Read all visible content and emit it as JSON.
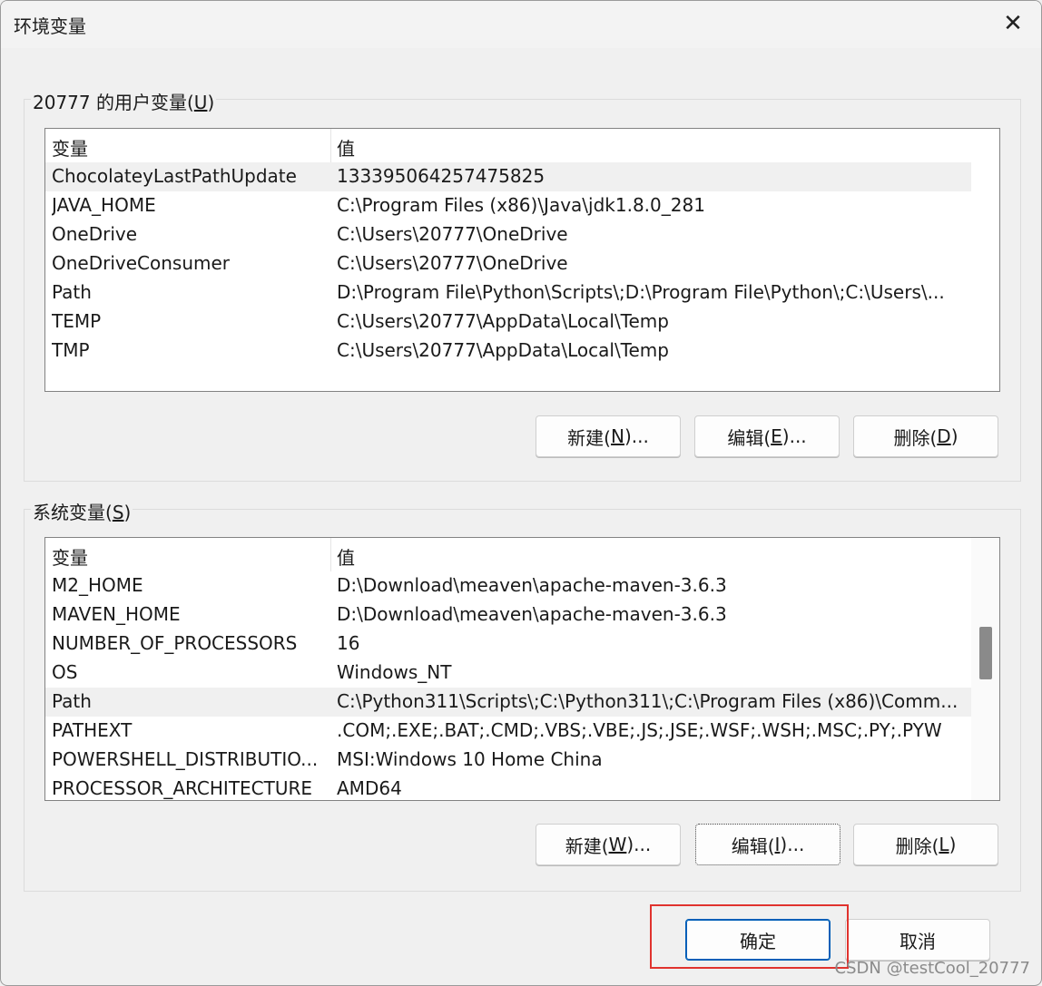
{
  "window": {
    "title": "环境变量",
    "close_glyph": "✕"
  },
  "user_vars": {
    "label_prefix": "20777 的用户变量(",
    "label_key": "U",
    "label_suffix": ")",
    "columns": [
      "变量",
      "值"
    ],
    "rows": [
      {
        "name": "ChocolateyLastPathUpdate",
        "value": "133395064257475825",
        "selected": true
      },
      {
        "name": "JAVA_HOME",
        "value": "C:\\Program Files (x86)\\Java\\jdk1.8.0_281"
      },
      {
        "name": "OneDrive",
        "value": "C:\\Users\\20777\\OneDrive"
      },
      {
        "name": "OneDriveConsumer",
        "value": "C:\\Users\\20777\\OneDrive"
      },
      {
        "name": "Path",
        "value": "D:\\Program File\\Python\\Scripts\\;D:\\Program File\\Python\\;C:\\Users\\..."
      },
      {
        "name": "TEMP",
        "value": "C:\\Users\\20777\\AppData\\Local\\Temp"
      },
      {
        "name": "TMP",
        "value": "C:\\Users\\20777\\AppData\\Local\\Temp"
      }
    ],
    "buttons": {
      "new": {
        "pre": "新建(",
        "key": "N",
        "post": ")..."
      },
      "edit": {
        "pre": "编辑(",
        "key": "E",
        "post": ")..."
      },
      "delete": {
        "pre": "删除(",
        "key": "D",
        "post": ")"
      }
    }
  },
  "system_vars": {
    "label_prefix": "系统变量(",
    "label_key": "S",
    "label_suffix": ")",
    "columns": [
      "变量",
      "值"
    ],
    "rows": [
      {
        "name": "M2_HOME",
        "value": "D:\\Download\\meaven\\apache-maven-3.6.3"
      },
      {
        "name": "MAVEN_HOME",
        "value": "D:\\Download\\meaven\\apache-maven-3.6.3"
      },
      {
        "name": "NUMBER_OF_PROCESSORS",
        "value": "16"
      },
      {
        "name": "OS",
        "value": "Windows_NT"
      },
      {
        "name": "Path",
        "value": "C:\\Python311\\Scripts\\;C:\\Python311\\;C:\\Program Files (x86)\\Comm...",
        "selected": true
      },
      {
        "name": "PATHEXT",
        "value": ".COM;.EXE;.BAT;.CMD;.VBS;.VBE;.JS;.JSE;.WSF;.WSH;.MSC;.PY;.PYW"
      },
      {
        "name": "POWERSHELL_DISTRIBUTIO...",
        "value": "MSI:Windows 10 Home China"
      },
      {
        "name": "PROCESSOR_ARCHITECTURE",
        "value": "AMD64"
      }
    ],
    "buttons": {
      "new": {
        "pre": "新建(",
        "key": "W",
        "post": ")..."
      },
      "edit": {
        "pre": "编辑(",
        "key": "I",
        "post": ")..."
      },
      "delete": {
        "pre": "删除(",
        "key": "L",
        "post": ")"
      }
    }
  },
  "footer": {
    "ok_label": "确定",
    "cancel_label": "取消",
    "highlight_color": "#e0332e"
  },
  "watermark": "CSDN @testCool_20777"
}
